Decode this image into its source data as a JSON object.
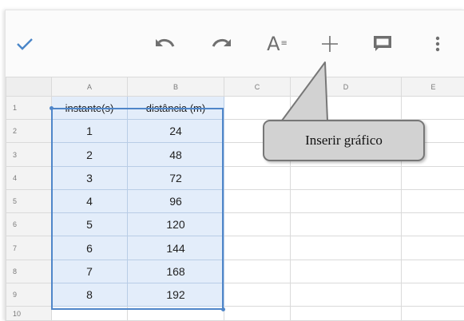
{
  "toolbar": {
    "done_icon": "checkmark-icon",
    "undo_icon": "undo-icon",
    "redo_icon": "redo-icon",
    "format_icon": "text-format-icon",
    "format_glyph": "A",
    "insert_icon": "plus-icon",
    "comment_icon": "comment-icon",
    "more_icon": "more-vertical-icon"
  },
  "columns": [
    "A",
    "B",
    "C",
    "D",
    "E"
  ],
  "rows": [
    {
      "num": "1",
      "a": "instante(s)",
      "b": "distância (m)"
    },
    {
      "num": "2",
      "a": "1",
      "b": "24"
    },
    {
      "num": "3",
      "a": "2",
      "b": "48"
    },
    {
      "num": "4",
      "a": "3",
      "b": "72"
    },
    {
      "num": "5",
      "a": "4",
      "b": "96"
    },
    {
      "num": "6",
      "a": "5",
      "b": "120"
    },
    {
      "num": "7",
      "a": "6",
      "b": "144"
    },
    {
      "num": "8",
      "a": "7",
      "b": "168"
    },
    {
      "num": "9",
      "a": "8",
      "b": "192"
    },
    {
      "num": "10",
      "a": "",
      "b": ""
    }
  ],
  "tooltip": {
    "text": "Inserir gráfico"
  },
  "colors": {
    "accent": "#4a86c8",
    "selection_fill": "#e3edfa",
    "tooltip_fill": "#d2d2d2"
  }
}
